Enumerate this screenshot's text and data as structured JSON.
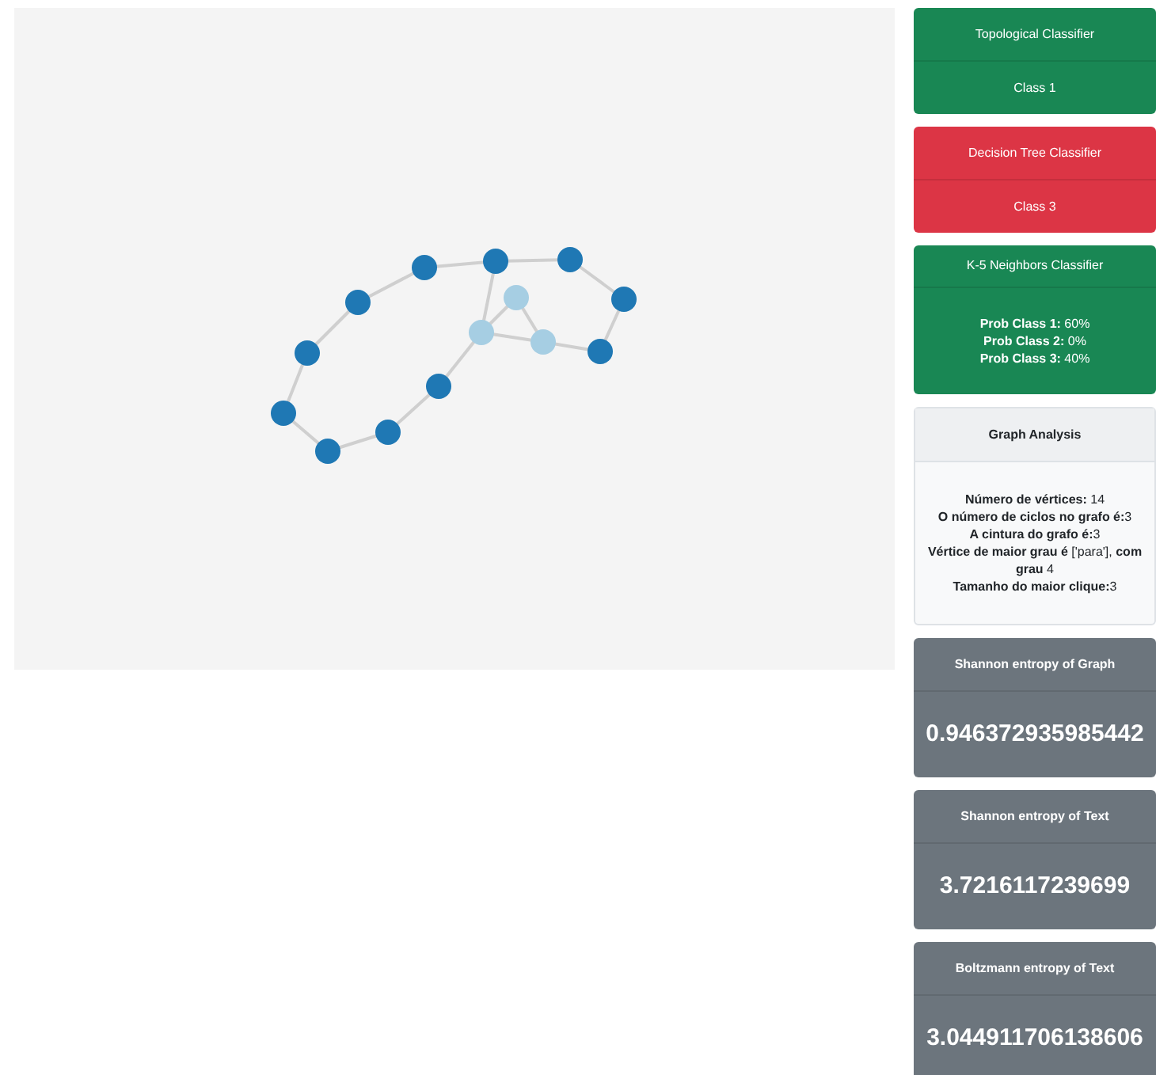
{
  "graph": {
    "nodes": [
      {
        "in_clique": false
      },
      {
        "in_clique": false
      },
      {
        "in_clique": false
      },
      {
        "in_clique": false
      },
      {
        "in_clique": false
      },
      {
        "in_clique": false
      },
      {
        "in_clique": false
      },
      {
        "in_clique": true
      },
      {
        "in_clique": true
      },
      {
        "in_clique": true
      },
      {
        "in_clique": false
      },
      {
        "in_clique": false
      },
      {
        "in_clique": false
      },
      {
        "in_clique": false
      }
    ]
  },
  "cards": [
    {
      "kind": "status",
      "color": "#198754",
      "title": "Topological Classifier",
      "lines": [
        "Class 1"
      ]
    },
    {
      "kind": "status",
      "color": "#dc3545",
      "title": "Decision Tree Classifier",
      "lines": [
        "Class 3"
      ]
    },
    {
      "kind": "list",
      "color": "#198754",
      "title": "K-5 Neighbors Classifier",
      "lines": [
        "**Prob Class 1:** 60%",
        "**Prob Class 2:** 0%",
        "**Prob Class 3:** 40%"
      ]
    },
    {
      "kind": "panel",
      "color": "#f8f9fa",
      "title": "Graph Analysis",
      "lines": [
        "**Número de vértices:** 14",
        "**O número de ciclos no grafo é:**3",
        "**A cintura do grafo é:**3",
        "**Vértice de maior grau é** ['para'], **com grau** 4",
        "**Tamanho do maior clique:**3"
      ]
    },
    {
      "kind": "value",
      "color": "#6c757d",
      "title": "Shannon entropy of Graph",
      "lines": [
        "0.946372935985442"
      ]
    },
    {
      "kind": "value",
      "color": "#6c757d",
      "title": "Shannon entropy of Text",
      "lines": [
        "3.7216117239699"
      ]
    },
    {
      "kind": "value",
      "color": "#6c757d",
      "title": "Boltzmann entropy of Text",
      "lines": [
        "3.044911706138606"
      ]
    }
  ]
}
